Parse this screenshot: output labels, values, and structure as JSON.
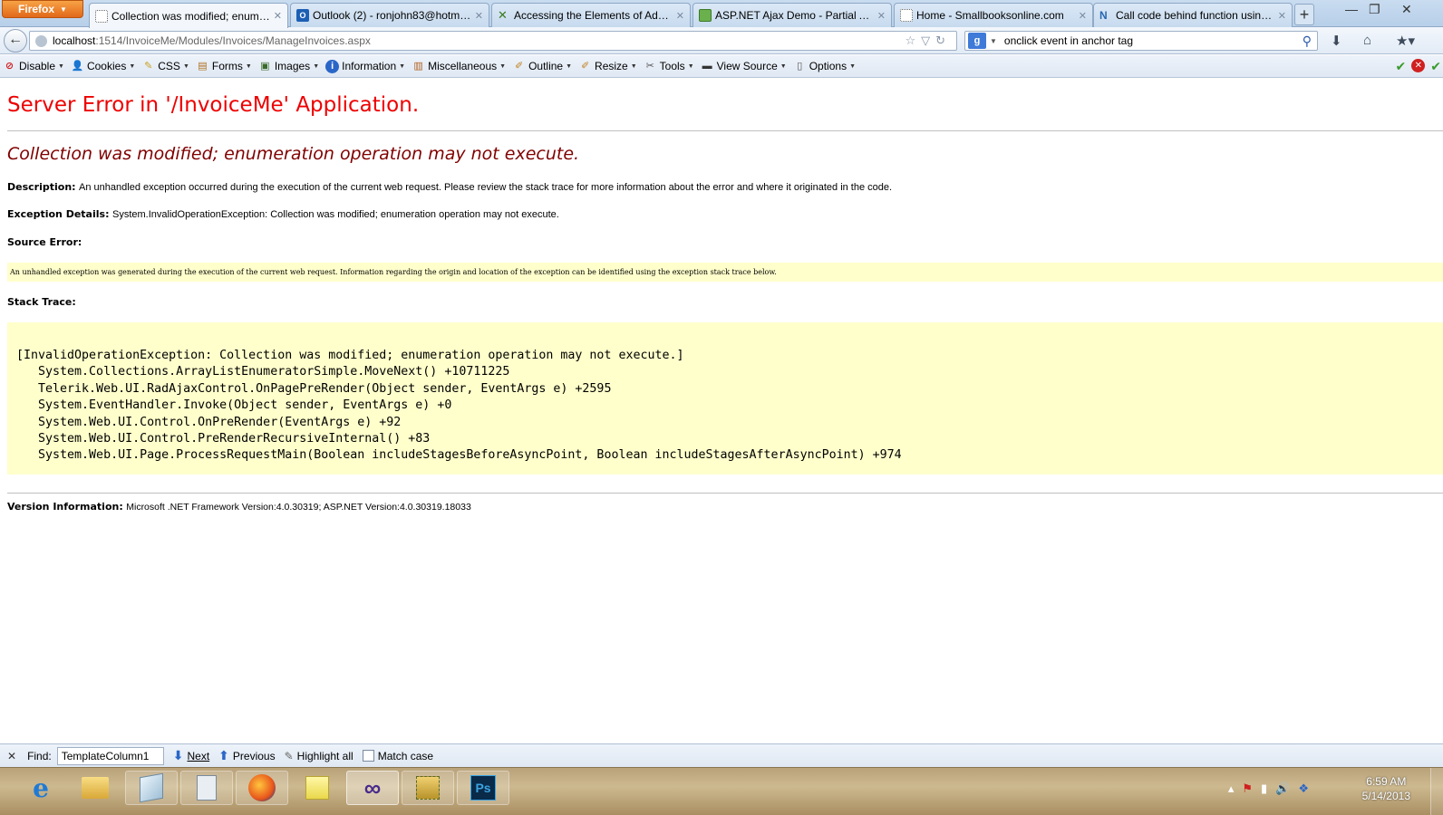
{
  "browser": {
    "menu_button": "Firefox",
    "tabs": [
      {
        "label": "Collection was modified; enume...",
        "icon": "blank-page-icon",
        "active": true
      },
      {
        "label": "Outlook (2) - ronjohn83@hotma...",
        "icon": "outlook-icon",
        "active": false
      },
      {
        "label": "Accessing the Elements of Adva...",
        "icon": "xhtml-icon",
        "active": false
      },
      {
        "label": "ASP.NET Ajax Demo - Partial Aja...",
        "icon": "aspnet-icon",
        "active": false
      },
      {
        "label": "Home - Smallbooksonline.com",
        "icon": "blank-page-icon",
        "active": false
      },
      {
        "label": "Call code behind function using ...",
        "icon": "telerik-icon",
        "active": false
      }
    ],
    "url_host": "localhost",
    "url_path": ":1514/InvoiceMe/Modules/Invoices/ManageInvoices.aspx",
    "search_value": "onclick event in anchor tag"
  },
  "devbar": {
    "items": [
      {
        "label": "Disable",
        "icon": "disable-icon"
      },
      {
        "label": "Cookies",
        "icon": "cookies-icon"
      },
      {
        "label": "CSS",
        "icon": "css-icon"
      },
      {
        "label": "Forms",
        "icon": "forms-icon"
      },
      {
        "label": "Images",
        "icon": "images-icon"
      },
      {
        "label": "Information",
        "icon": "information-icon"
      },
      {
        "label": "Miscellaneous",
        "icon": "miscellaneous-icon"
      },
      {
        "label": "Outline",
        "icon": "outline-icon"
      },
      {
        "label": "Resize",
        "icon": "resize-icon"
      },
      {
        "label": "Tools",
        "icon": "tools-icon"
      },
      {
        "label": "View Source",
        "icon": "view-source-icon"
      },
      {
        "label": "Options",
        "icon": "options-icon"
      }
    ]
  },
  "page": {
    "title": "Server Error in '/InvoiceMe' Application.",
    "error_message": "Collection was modified; enumeration operation may not execute.",
    "description_label": "Description:",
    "description_text": "An unhandled exception occurred during the execution of the current web request. Please review the stack trace for more information about the error and where it originated in the code.",
    "exception_label": "Exception Details:",
    "exception_text": "System.InvalidOperationException: Collection was modified; enumeration operation may not execute.",
    "source_error_label": "Source Error:",
    "source_error_text": "An unhandled exception was generated during the execution of the current web request. Information regarding the origin and location of the exception can be identified using the exception stack trace below.",
    "stack_trace_label": "Stack Trace:",
    "stack_trace_lines": [
      "[InvalidOperationException: Collection was modified; enumeration operation may not execute.]",
      "   System.Collections.ArrayListEnumeratorSimple.MoveNext() +10711225",
      "   Telerik.Web.UI.RadAjaxControl.OnPagePreRender(Object sender, EventArgs e) +2595",
      "   System.EventHandler.Invoke(Object sender, EventArgs e) +0",
      "   System.Web.UI.Control.OnPreRender(EventArgs e) +92",
      "   System.Web.UI.Control.PreRenderRecursiveInternal() +83",
      "   System.Web.UI.Page.ProcessRequestMain(Boolean includeStagesBeforeAsyncPoint, Boolean includeStagesAfterAsyncPoint) +974"
    ],
    "version_label": "Version Information:",
    "version_text": "Microsoft .NET Framework Version:4.0.30319; ASP.NET Version:4.0.30319.18033"
  },
  "findbar": {
    "label": "Find:",
    "value": "TemplateColumn1",
    "next_label": "Next",
    "previous_label": "Previous",
    "highlight_label": "Highlight all",
    "match_case_label": "Match case"
  },
  "taskbar": {
    "apps": [
      "internet-explorer-icon",
      "file-explorer-icon",
      "notepad-icon",
      "calculator-icon",
      "firefox-icon",
      "sticky-notes-icon",
      "visual-studio-icon",
      "tool-icon",
      "photoshop-icon"
    ],
    "photoshop_label": "Ps",
    "time": "6:59 AM",
    "date": "5/14/2013"
  },
  "colors": {
    "title_red": "#e00000",
    "message_maroon": "#800000",
    "code_background": "#ffffcc",
    "firefox_orange": "#e2681a"
  }
}
